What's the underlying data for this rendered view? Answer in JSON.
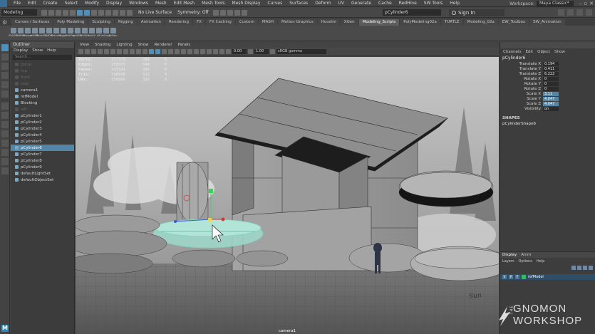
{
  "menubar": {
    "items": [
      "File",
      "Edit",
      "Create",
      "Select",
      "Modify",
      "Display",
      "Windows",
      "Mesh",
      "Edit Mesh",
      "Mesh Tools",
      "Mesh Display",
      "Curves",
      "Surfaces",
      "Deform",
      "UV",
      "Generate",
      "Cache",
      "RedHine",
      "SW Tools",
      "Help"
    ],
    "workspace_label": "Workspace:",
    "workspace_value": "Maya Classic*"
  },
  "statusline": {
    "mode": "Modeling",
    "live_surface": "No Live Surface",
    "symmetry": "Symmetry: Off",
    "object_field": "pCylinder6",
    "sign_in": "Sign In"
  },
  "shelf_tabs": [
    "Curves / Surfaces",
    "Poly Modeling",
    "Sculpting",
    "Rigging",
    "Animation",
    "Rendering",
    "FX",
    "FX Caching",
    "Custom",
    "MASH",
    "Motion Graphics",
    "Houdini",
    "XGen",
    "Modeling_Scripts",
    "PolyModeling02a",
    "TURTLE",
    "Modeling_02a",
    "EW_Toolbox",
    "SW_Animation"
  ],
  "shelf_active": "Modeling_Scripts",
  "shelf_buttons": [
    "PickSM",
    "OldEdit",
    "Stepper",
    "shMSC",
    "BevelGC",
    "LatDef",
    "Extrude",
    "Toggle",
    "GldUVs",
    "gridSM",
    "GridUV",
    "AveUV",
    "ollf",
    "zeCopy",
    "SnBon"
  ],
  "outliner": {
    "title": "Outliner",
    "menu": [
      "Display",
      "Show",
      "Help"
    ],
    "search_placeholder": "Search...",
    "items": [
      {
        "label": "persp",
        "dim": true
      },
      {
        "label": "top",
        "dim": true
      },
      {
        "label": "front",
        "dim": true
      },
      {
        "label": "side",
        "dim": true
      },
      {
        "label": "camera1",
        "dim": false
      },
      {
        "label": "refModel",
        "dim": false
      },
      {
        "label": "Blocking",
        "dim": false
      },
      {
        "label": "left",
        "dim": true
      },
      {
        "label": "pCylinder1",
        "dim": false
      },
      {
        "label": "pCylinder2",
        "dim": false
      },
      {
        "label": "pCylinder3",
        "dim": false
      },
      {
        "label": "pCylinder4",
        "dim": false
      },
      {
        "label": "pCylinder5",
        "dim": false
      },
      {
        "label": "pCylinder6",
        "dim": false,
        "selected": true
      },
      {
        "label": "pCylinder7",
        "dim": false
      },
      {
        "label": "pCylinder8",
        "dim": false
      },
      {
        "label": "pCylinder9",
        "dim": false
      },
      {
        "label": "defaultLightSet",
        "dim": false
      },
      {
        "label": "defaultObjectSet",
        "dim": false
      }
    ]
  },
  "viewport": {
    "menu": [
      "View",
      "Shading",
      "Lighting",
      "Show",
      "Renderer",
      "Panels"
    ],
    "exposure": "0.00",
    "gamma": "1.00",
    "color_space": "sRGB gamma",
    "hud": [
      {
        "label": "Verts:",
        "a": "117371",
        "b": "288",
        "c": "0"
      },
      {
        "label": "Edges:",
        "a": "250975",
        "b": "544",
        "c": "0"
      },
      {
        "label": "Faces:",
        "a": "143541",
        "b": "260",
        "c": "0"
      },
      {
        "label": "Tris:",
        "a": "198998",
        "b": "512",
        "c": "0"
      },
      {
        "label": "UVs:",
        "a": "150008",
        "b": "320",
        "c": "0"
      }
    ],
    "camera": "camera1",
    "signature": "Sun"
  },
  "channelbox": {
    "tabs": [
      "Channels",
      "Edit",
      "Object",
      "Show"
    ],
    "object": "pCylinder6",
    "attrs": [
      {
        "name": "Translate X",
        "value": "0.194",
        "hl": false
      },
      {
        "name": "Translate Y",
        "value": "0.411",
        "hl": false
      },
      {
        "name": "Translate Z",
        "value": "6.222",
        "hl": false
      },
      {
        "name": "Rotate X",
        "value": "0",
        "hl": false
      },
      {
        "name": "Rotate Y",
        "value": "0",
        "hl": false
      },
      {
        "name": "Rotate Z",
        "value": "0",
        "hl": false
      },
      {
        "name": "Scale X",
        "value": "3.11",
        "hl": true
      },
      {
        "name": "Scale Y",
        "value": "4.047",
        "hl": true
      },
      {
        "name": "Scale Z",
        "value": "4.047",
        "hl": true
      },
      {
        "name": "Visibility",
        "value": "on",
        "hl": false
      }
    ],
    "shapes_header": "SHAPES",
    "shape_name": "pCylinderShape6"
  },
  "layers": {
    "tabs": [
      "Display",
      "Anim"
    ],
    "menu": [
      "Layers",
      "Options",
      "Help"
    ],
    "row": {
      "v": "V",
      "p": "P",
      "t": "T",
      "name": "refModel"
    }
  },
  "watermark": {
    "the": "THE",
    "line1": "GNOMON",
    "line2": "WORKSHOP"
  }
}
